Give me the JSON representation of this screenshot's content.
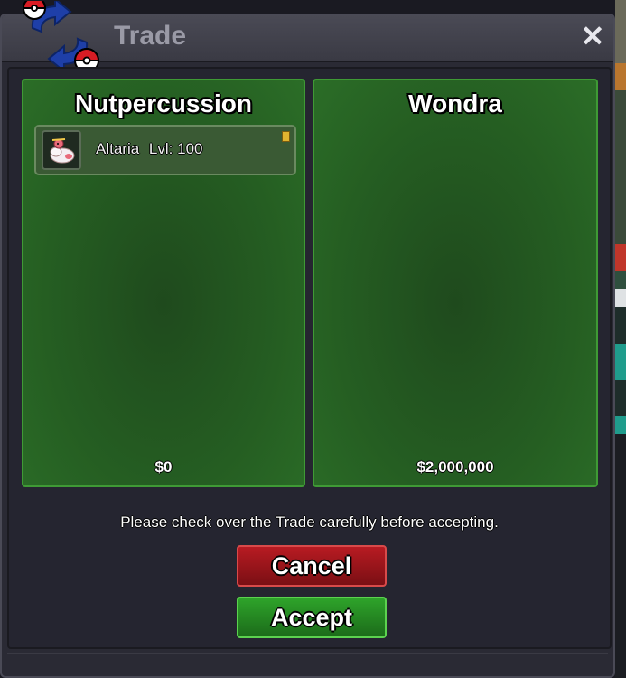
{
  "window": {
    "title": "Trade",
    "close_glyph": "✕"
  },
  "trader_left": {
    "name": "Nutpercussion",
    "money": "$0",
    "items": [
      {
        "name": "Altaria",
        "level_label": "Lvl:",
        "level": "100",
        "icon": "altaria-sprite-icon"
      }
    ]
  },
  "trader_right": {
    "name": "Wondra",
    "money": "$2,000,000",
    "items": []
  },
  "notice": "Please check over the Trade carefully before accepting.",
  "buttons": {
    "cancel": "Cancel",
    "accept": "Accept"
  },
  "colors": {
    "panel_green": "#255e22",
    "cancel_red": "#b81b22",
    "accept_green": "#2ea32a",
    "window_bg": "#2a2a34"
  }
}
